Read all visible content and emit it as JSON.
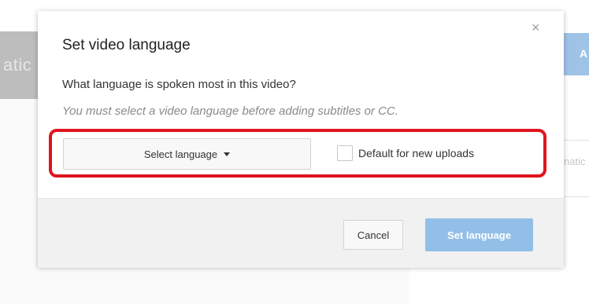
{
  "background": {
    "left_bar_text": "atic",
    "right_button_text": "A",
    "right_field_text": "natic"
  },
  "dialog": {
    "title": "Set video language",
    "close_symbol": "×",
    "question": "What language is spoken most in this video?",
    "hint": "You must select a video language before adding subtitles or CC.",
    "language_select": {
      "label": "Select language",
      "icon": "caret-down-icon"
    },
    "default_checkbox": {
      "label": "Default for new uploads",
      "checked": false
    },
    "buttons": {
      "cancel_label": "Cancel",
      "set_language_label": "Set language"
    }
  },
  "colors": {
    "primary_button": "#92bfe8",
    "highlight": "#e0141e"
  }
}
